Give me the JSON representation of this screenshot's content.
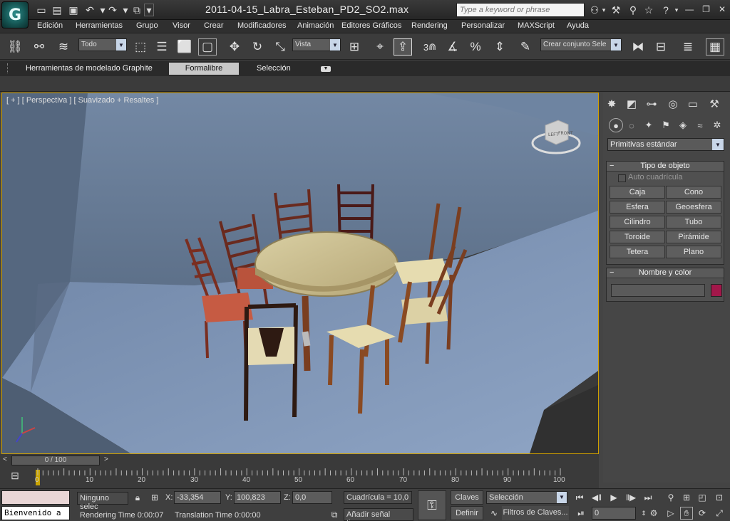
{
  "window": {
    "title": "2011-04-15_Labra_Esteban_PD2_SO2.max",
    "search_placeholder": "Type a keyword or phrase"
  },
  "menu": [
    "Edición",
    "Herramientas",
    "Grupo",
    "Visor",
    "Crear",
    "Modificadores",
    "Animación",
    "Editores Gráficos",
    "Rendering",
    "Personalizar",
    "MAXScript",
    "Ayuda"
  ],
  "toolbar": {
    "filter_value": "Todo",
    "coord_value": "Vista",
    "snap_label": "3",
    "named_set_value": "Crear conjunto Sele"
  },
  "ribbon": {
    "tabs": [
      "Herramientas de modelado Graphite",
      "Formalibre",
      "Selección"
    ],
    "active_tab": "Formalibre"
  },
  "viewport": {
    "label": "[ + ] [ Perspectiva ] [ Suavizado + Resaltes ]",
    "cube_left": "LEFT",
    "cube_front": "FRONT"
  },
  "command_panel": {
    "category": "Primitivas estándar",
    "object_type_title": "Tipo de objeto",
    "autogrid_label": "Auto cuadrícula",
    "object_buttons": [
      "Caja",
      "Cono",
      "Esfera",
      "Geoesfera",
      "Cilindro",
      "Tubo",
      "Toroide",
      "Pirámide",
      "Tetera",
      "Plano"
    ],
    "name_color_title": "Nombre y color",
    "object_color": "#a2174a"
  },
  "timeline": {
    "slider_label": "0 / 100",
    "ticks": [
      "0",
      "10",
      "20",
      "30",
      "40",
      "50",
      "60",
      "70",
      "80",
      "90",
      "100"
    ]
  },
  "status": {
    "welcome": "Bienvenido a",
    "selection": "Ninguno selec",
    "x_label": "X:",
    "x_value": "-33,354",
    "y_label": "Y:",
    "y_value": "100,823",
    "z_label": "Z:",
    "z_value": "0,0",
    "grid": "Cuadrícula = 10,0",
    "rendering_time": "Rendering Time  0:00:07",
    "translation_time": "Translation Time  0:00:00",
    "add_time_tag": "Añadir señal tiempo",
    "keys_button": "Claves",
    "define_button": "Definir",
    "key_mode_value": "Selección",
    "key_filters": "Filtros de Claves...",
    "frame_value": "0"
  }
}
